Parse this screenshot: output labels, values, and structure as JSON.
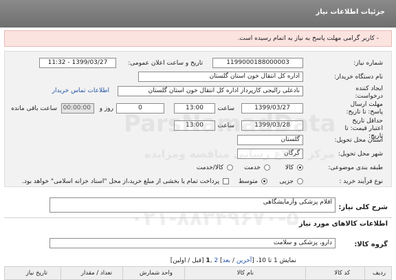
{
  "header": {
    "title": "جزئیات اطلاعات نیاز"
  },
  "alert": {
    "text": "- کاربر گرامی مهلت پاسخ به نیاز به اتمام رسیده است."
  },
  "form": {
    "need_number": {
      "label": "شماره نیاز:",
      "value": "1199000188000003"
    },
    "announce_datetime": {
      "label": "تاریخ و ساعت اعلان عمومی:",
      "value": "1399/03/27 - 11:32"
    },
    "buyer_org": {
      "label": "نام دستگاه خریدار:",
      "value": "اداره کل انتقال خون استان گلستان"
    },
    "requester": {
      "label": "ایجاد کننده درخواست:",
      "value": "نادعلی رالیجی کارپرداز اداره کل انتقال خون استان گلستان"
    },
    "buyer_contact_link": "اطلاعات تماس خریدار",
    "reply_deadline": {
      "label": "مهلت ارسال پاسخ: تا تاریخ:",
      "date": "1399/03/27",
      "time_label": "ساعت",
      "time": "13:00",
      "days": "0",
      "days_label": "روز و",
      "remaining": "00:00:00",
      "remaining_label": "ساعت باقی مانده"
    },
    "price_validity": {
      "label": "حداقل تاریخ اعتبار قیمت: تا تاریخ:",
      "date": "1399/03/28",
      "time_label": "ساعت",
      "time": "13:00"
    },
    "delivery_province": {
      "label": "استان محل تحویل:",
      "value": "گلستان"
    },
    "delivery_city": {
      "label": "شهر محل تحویل:",
      "value": "گرگان"
    },
    "category": {
      "label": "طبقه بندی موضوعی:",
      "options": [
        "کالا",
        "خدمت",
        "کالا/خدمت"
      ],
      "selected": "کالا"
    },
    "process_type": {
      "label": "نوع فرآیند خرید :",
      "options": [
        "جزیی",
        "متوسط"
      ],
      "selected": "متوسط",
      "payment_note": "پرداخت تمام یا بخشی از مبلغ خرید،از محل \"اسناد خزانه اسلامی\" خواهد بود."
    }
  },
  "summary": {
    "title": "شرح کلی نیاز:",
    "value": "اقلام پزشکی وآزمایشگاهی"
  },
  "goods_info": {
    "title": "اطلاعات کالاهای مورد نیاز"
  },
  "goods_group": {
    "label": "گروه کالا:",
    "value": "دارو، پزشکی و سلامت"
  },
  "pager": {
    "prefix": "نمایش 1 تا 10، [",
    "last": "آخرین",
    "sep1": " / ",
    "next": "بعد",
    "mid": "] ",
    "page2": "2",
    "sep2": " ,",
    "page1": "1",
    "suffix": " [قبل / اولین]"
  },
  "table": {
    "columns": [
      "ردیف",
      "کد کالا",
      "نام کالا",
      "واحد شمارش",
      "تعداد / مقدار",
      "تاریخ نیاز"
    ]
  },
  "watermark": {
    "text1": "ParsNamadData",
    "text2": "۰۲۱-۸۸۳۴۹۶۷۰-۵",
    "text3": "مرکز اطلاع رسانی مناقصه ومزایده"
  }
}
